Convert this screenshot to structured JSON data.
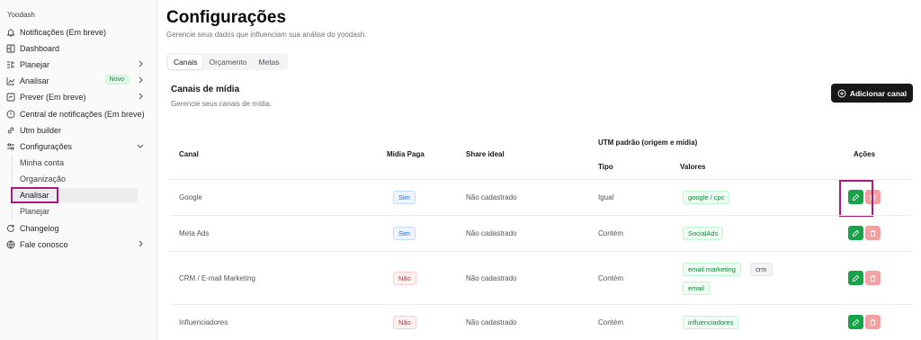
{
  "app": {
    "brand": "Yoodash"
  },
  "sidebar": {
    "items": [
      {
        "label": "Notificações (Em breve)",
        "icon": "bell-icon"
      },
      {
        "label": "Dashboard",
        "icon": "dashboard-icon"
      },
      {
        "label": "Planejar",
        "icon": "planner-icon",
        "chevron": "right"
      },
      {
        "label": "Analisar",
        "icon": "chart-line-icon",
        "badge": "Novo",
        "chevron": "right"
      },
      {
        "label": "Prever (Em breve)",
        "icon": "forecast-icon",
        "chevron": "right"
      },
      {
        "label": "Central de notificações (Em breve)",
        "icon": "alert-circle-icon"
      },
      {
        "label": "Utm builder",
        "icon": "link-icon"
      },
      {
        "label": "Configurações",
        "icon": "sliders-icon",
        "chevron": "down"
      }
    ],
    "sub_items": [
      {
        "label": "Minha conta"
      },
      {
        "label": "Organização"
      },
      {
        "label": "Analisar"
      },
      {
        "label": "Planejar"
      }
    ],
    "bottom_items": [
      {
        "label": "Changelog",
        "icon": "refresh-icon"
      },
      {
        "label": "Fale conosco",
        "icon": "globe-icon",
        "chevron": "right"
      }
    ]
  },
  "page": {
    "title": "Configurações",
    "subtitle": "Gerencie seus dados que influenciam sua análise do yoodash."
  },
  "tabs": [
    {
      "label": "Canais",
      "active": true
    },
    {
      "label": "Orçamento",
      "active": false
    },
    {
      "label": "Metas",
      "active": false
    }
  ],
  "card": {
    "title": "Canais de mídia",
    "subtitle": "Gerencie seus canais de mídia.",
    "add_button": "Adicionar canal"
  },
  "table": {
    "headers": {
      "canal": "Canal",
      "midia_paga": "Mídia Paga",
      "share_ideal": "Share ideal",
      "utm": "UTM padrão (origem e mídia)",
      "tipo": "Tipo",
      "valores": "Valores",
      "acoes": "Ações"
    },
    "rows": [
      {
        "canal": "Google",
        "midia_paga": "Sim",
        "share": "Não cadastrado",
        "tipo": "Igual",
        "valores": [
          "google / cpc"
        ]
      },
      {
        "canal": "Meta Ads",
        "midia_paga": "Sim",
        "share": "Não cadastrado",
        "tipo": "Contém",
        "valores": [
          "SocialAds"
        ]
      },
      {
        "canal": "CRM / E-mail Marketing",
        "midia_paga": "Não",
        "share": "Não cadastrado",
        "tipo": "Contém",
        "valores": [
          "email marketing",
          "crm",
          "email"
        ]
      },
      {
        "canal": "Influenciadores",
        "midia_paga": "Não",
        "share": "Não cadastrado",
        "tipo": "Contém",
        "valores": [
          "influenciadores"
        ]
      }
    ]
  },
  "colors": {
    "accent_dark": "#18181b",
    "edit_green": "#16a34a",
    "delete_red": "#f2a0a0",
    "highlight": "#a21d7d"
  }
}
